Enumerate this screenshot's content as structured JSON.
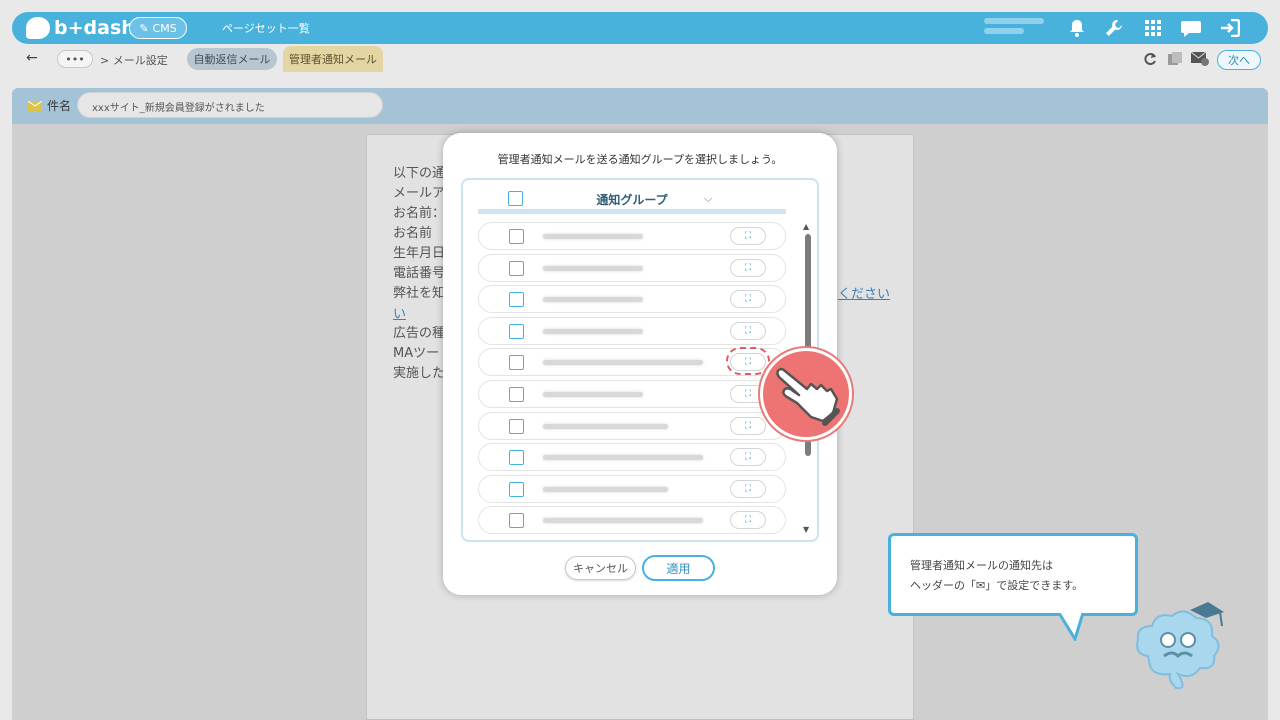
{
  "header": {
    "logo_text": "b+dash",
    "cms_label": "CMS",
    "page_set_label": "ページセット一覧",
    "icons": [
      "bell-icon",
      "wrench-icon",
      "grid-icon",
      "chat-icon",
      "logout-icon"
    ]
  },
  "subbar": {
    "back_glyph": "←",
    "more_glyph": "•••",
    "crumb": "> メール設定",
    "tab_auto_reply": "自動返信メール",
    "tab_admin_notify": "管理者通知メール",
    "next_label": "次へ",
    "icons": [
      "refresh-icon",
      "copy-icon",
      "mail-settings-icon"
    ]
  },
  "subject": {
    "label": "件名",
    "value": "xxxサイト_新規会員登録がされました"
  },
  "document": {
    "lines": [
      "以下の通",
      "メールア",
      "お名前：",
      "お名前",
      "生年月日",
      "電話番号",
      "弊社を知",
      "い",
      "広告の種",
      "MAツー",
      "実施した"
    ],
    "link_fragment_right": "ください",
    "link_fragment_left": "い"
  },
  "modal": {
    "title": "管理者通知メールを送る通知グループを選択しましょう。",
    "column_header": "通知グループ",
    "expand_glyph": "⛶",
    "rows": [
      {
        "checked": false,
        "highlighted": false
      },
      {
        "checked": false,
        "highlighted": false
      },
      {
        "checked": false,
        "highlighted": false
      },
      {
        "checked": false,
        "highlighted": false
      },
      {
        "checked": false,
        "highlighted": true
      },
      {
        "checked": false,
        "highlighted": false
      },
      {
        "checked": false,
        "highlighted": false
      },
      {
        "checked": false,
        "highlighted": false
      },
      {
        "checked": false,
        "highlighted": false
      },
      {
        "checked": false,
        "highlighted": false
      }
    ],
    "cancel_label": "キャンセル",
    "apply_label": "適用"
  },
  "tip": {
    "line1": "管理者通知メールの通知先は",
    "line2": "ヘッダーの「✉」で設定できます。"
  },
  "colors": {
    "accent": "#48b2dd",
    "highlight": "#e55a5a",
    "hand_circle": "#ee7373"
  }
}
